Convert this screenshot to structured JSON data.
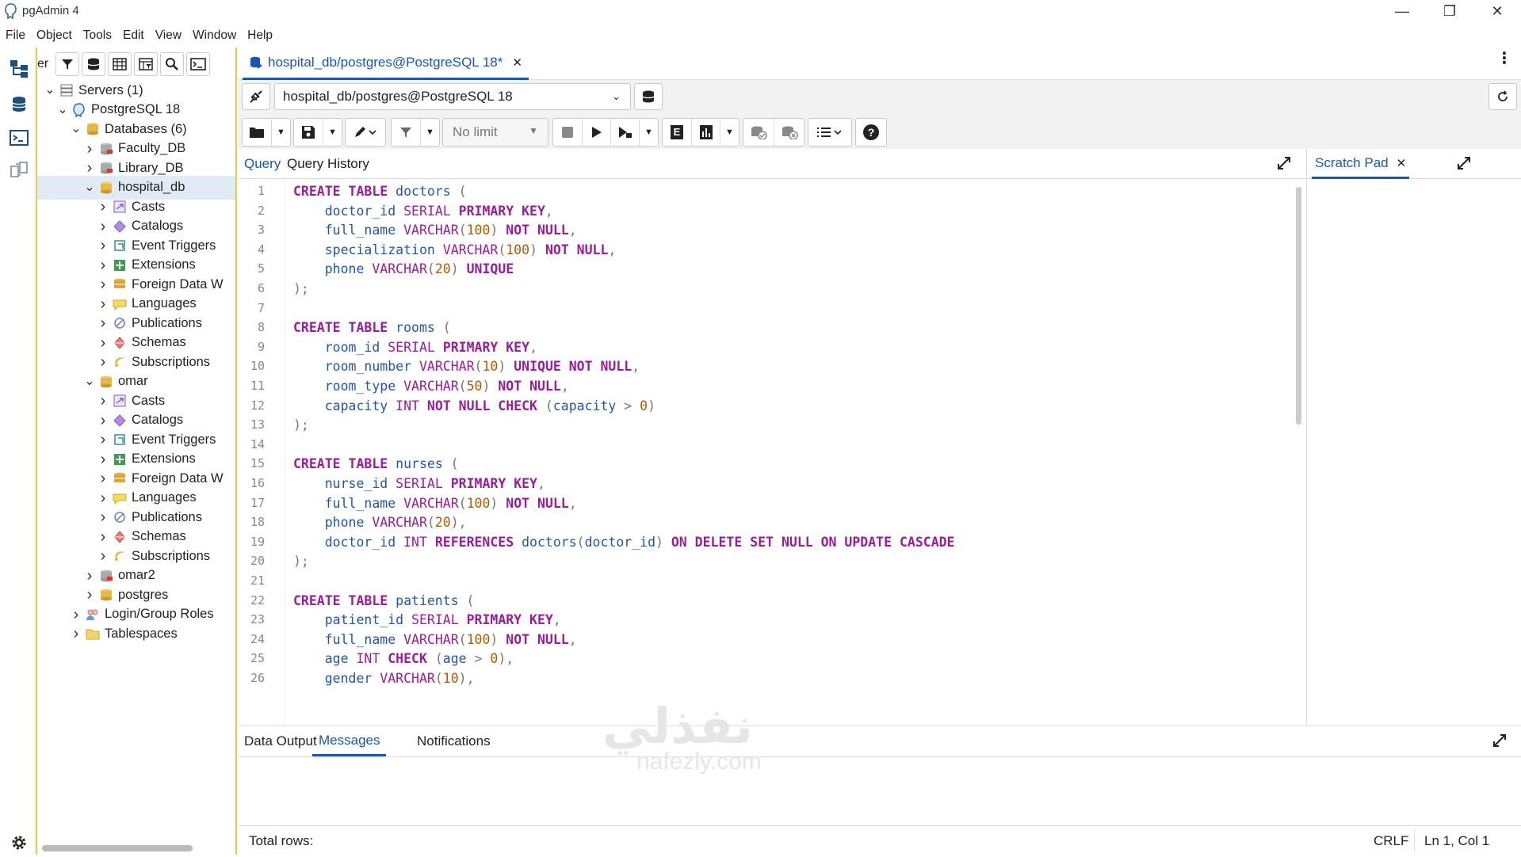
{
  "window": {
    "title": "pgAdmin 4",
    "minimize": "—",
    "maximize": "❐",
    "close": "✕"
  },
  "menu": [
    "File",
    "Object",
    "Tools",
    "Edit",
    "View",
    "Window",
    "Help"
  ],
  "tree_panel": {
    "partial_title": "er"
  },
  "tree": [
    {
      "label": "Servers (1)",
      "depth": 0,
      "expanded": true,
      "icon": "servers-icon"
    },
    {
      "label": "PostgreSQL 18",
      "depth": 1,
      "expanded": true,
      "icon": "postgres-elephant-icon"
    },
    {
      "label": "Databases (6)",
      "depth": 2,
      "expanded": true,
      "icon": "databases-icon"
    },
    {
      "label": "Faculty_DB",
      "depth": 3,
      "expanded": false,
      "icon": "database-disconnected-icon"
    },
    {
      "label": "Library_DB",
      "depth": 3,
      "expanded": false,
      "icon": "database-disconnected-icon"
    },
    {
      "label": "hospital_db",
      "depth": 3,
      "expanded": true,
      "icon": "database-icon",
      "selected": true
    },
    {
      "label": "Casts",
      "depth": 4,
      "expanded": false,
      "icon": "casts-icon"
    },
    {
      "label": "Catalogs",
      "depth": 4,
      "expanded": false,
      "icon": "catalogs-icon"
    },
    {
      "label": "Event Triggers",
      "depth": 4,
      "expanded": false,
      "icon": "event-triggers-icon"
    },
    {
      "label": "Extensions",
      "depth": 4,
      "expanded": false,
      "icon": "extensions-icon"
    },
    {
      "label": "Foreign Data W",
      "depth": 4,
      "expanded": false,
      "icon": "foreign-data-icon"
    },
    {
      "label": "Languages",
      "depth": 4,
      "expanded": false,
      "icon": "languages-icon"
    },
    {
      "label": "Publications",
      "depth": 4,
      "expanded": false,
      "icon": "publications-icon"
    },
    {
      "label": "Schemas",
      "depth": 4,
      "expanded": false,
      "icon": "schemas-icon"
    },
    {
      "label": "Subscriptions",
      "depth": 4,
      "expanded": false,
      "icon": "subscriptions-icon"
    },
    {
      "label": "omar",
      "depth": 3,
      "expanded": true,
      "icon": "database-icon"
    },
    {
      "label": "Casts",
      "depth": 4,
      "expanded": false,
      "icon": "casts-icon"
    },
    {
      "label": "Catalogs",
      "depth": 4,
      "expanded": false,
      "icon": "catalogs-icon"
    },
    {
      "label": "Event Triggers",
      "depth": 4,
      "expanded": false,
      "icon": "event-triggers-icon"
    },
    {
      "label": "Extensions",
      "depth": 4,
      "expanded": false,
      "icon": "extensions-icon"
    },
    {
      "label": "Foreign Data W",
      "depth": 4,
      "expanded": false,
      "icon": "foreign-data-icon"
    },
    {
      "label": "Languages",
      "depth": 4,
      "expanded": false,
      "icon": "languages-icon"
    },
    {
      "label": "Publications",
      "depth": 4,
      "expanded": false,
      "icon": "publications-icon"
    },
    {
      "label": "Schemas",
      "depth": 4,
      "expanded": false,
      "icon": "schemas-icon"
    },
    {
      "label": "Subscriptions",
      "depth": 4,
      "expanded": false,
      "icon": "subscriptions-icon"
    },
    {
      "label": "omar2",
      "depth": 3,
      "expanded": false,
      "icon": "database-disconnected-icon"
    },
    {
      "label": "postgres",
      "depth": 3,
      "expanded": false,
      "icon": "database-icon"
    },
    {
      "label": "Login/Group Roles",
      "depth": 2,
      "expanded": false,
      "icon": "roles-icon"
    },
    {
      "label": "Tablespaces",
      "depth": 2,
      "expanded": false,
      "icon": "tablespaces-icon"
    }
  ],
  "query_tab": {
    "label": "hospital_db/postgres@PostgreSQL 18*",
    "close": "✕"
  },
  "connection": {
    "value": "hospital_db/postgres@PostgreSQL 18"
  },
  "toolbar": {
    "limit": "No limit",
    "explain_label": "E"
  },
  "editor_tabs": {
    "query": "Query",
    "history": "Query History",
    "scratch": "Scratch Pad",
    "scratch_close": "✕"
  },
  "code_lines": [
    [
      [
        "kw",
        "CREATE TABLE "
      ],
      [
        "id",
        "doctors"
      ],
      [
        "pu",
        " ("
      ]
    ],
    [
      [
        "",
        "    "
      ],
      [
        "id",
        "doctor_id"
      ],
      [
        "ty",
        " SERIAL "
      ],
      [
        "kw",
        "PRIMARY KEY"
      ],
      [
        "pu",
        ","
      ]
    ],
    [
      [
        "",
        "    "
      ],
      [
        "id",
        "full_name"
      ],
      [
        "ty",
        " VARCHAR"
      ],
      [
        "pu",
        "("
      ],
      [
        "num",
        "100"
      ],
      [
        "pu",
        ") "
      ],
      [
        "kw",
        "NOT NULL"
      ],
      [
        "pu",
        ","
      ]
    ],
    [
      [
        "",
        "    "
      ],
      [
        "id",
        "specialization"
      ],
      [
        "ty",
        " VARCHAR"
      ],
      [
        "pu",
        "("
      ],
      [
        "num",
        "100"
      ],
      [
        "pu",
        ") "
      ],
      [
        "kw",
        "NOT NULL"
      ],
      [
        "pu",
        ","
      ]
    ],
    [
      [
        "",
        "    "
      ],
      [
        "id",
        "phone"
      ],
      [
        "ty",
        " VARCHAR"
      ],
      [
        "pu",
        "("
      ],
      [
        "num",
        "20"
      ],
      [
        "pu",
        ") "
      ],
      [
        "kw",
        "UNIQUE"
      ]
    ],
    [
      [
        "pu",
        ");"
      ]
    ],
    [
      [
        "",
        ""
      ]
    ],
    [
      [
        "kw",
        "CREATE TABLE "
      ],
      [
        "id",
        "rooms"
      ],
      [
        "pu",
        " ("
      ]
    ],
    [
      [
        "",
        "    "
      ],
      [
        "id",
        "room_id"
      ],
      [
        "ty",
        " SERIAL "
      ],
      [
        "kw",
        "PRIMARY KEY"
      ],
      [
        "pu",
        ","
      ]
    ],
    [
      [
        "",
        "    "
      ],
      [
        "id",
        "room_number"
      ],
      [
        "ty",
        " VARCHAR"
      ],
      [
        "pu",
        "("
      ],
      [
        "num",
        "10"
      ],
      [
        "pu",
        ") "
      ],
      [
        "kw",
        "UNIQUE NOT NULL"
      ],
      [
        "pu",
        ","
      ]
    ],
    [
      [
        "",
        "    "
      ],
      [
        "id",
        "room_type"
      ],
      [
        "ty",
        " VARCHAR"
      ],
      [
        "pu",
        "("
      ],
      [
        "num",
        "50"
      ],
      [
        "pu",
        ") "
      ],
      [
        "kw",
        "NOT NULL"
      ],
      [
        "pu",
        ","
      ]
    ],
    [
      [
        "",
        "    "
      ],
      [
        "id",
        "capacity"
      ],
      [
        "ty",
        " INT "
      ],
      [
        "kw",
        "NOT NULL CHECK"
      ],
      [
        "pu",
        " ("
      ],
      [
        "id",
        "capacity"
      ],
      [
        "pu",
        " > "
      ],
      [
        "num",
        "0"
      ],
      [
        "pu",
        ")"
      ]
    ],
    [
      [
        "pu",
        ");"
      ]
    ],
    [
      [
        "",
        ""
      ]
    ],
    [
      [
        "kw",
        "CREATE TABLE "
      ],
      [
        "id",
        "nurses"
      ],
      [
        "pu",
        " ("
      ]
    ],
    [
      [
        "",
        "    "
      ],
      [
        "id",
        "nurse_id"
      ],
      [
        "ty",
        " SERIAL "
      ],
      [
        "kw",
        "PRIMARY KEY"
      ],
      [
        "pu",
        ","
      ]
    ],
    [
      [
        "",
        "    "
      ],
      [
        "id",
        "full_name"
      ],
      [
        "ty",
        " VARCHAR"
      ],
      [
        "pu",
        "("
      ],
      [
        "num",
        "100"
      ],
      [
        "pu",
        ") "
      ],
      [
        "kw",
        "NOT NULL"
      ],
      [
        "pu",
        ","
      ]
    ],
    [
      [
        "",
        "    "
      ],
      [
        "id",
        "phone"
      ],
      [
        "ty",
        " VARCHAR"
      ],
      [
        "pu",
        "("
      ],
      [
        "num",
        "20"
      ],
      [
        "pu",
        "),"
      ]
    ],
    [
      [
        "",
        "    "
      ],
      [
        "id",
        "doctor_id"
      ],
      [
        "ty",
        " INT "
      ],
      [
        "kw",
        "REFERENCES "
      ],
      [
        "id",
        "doctors"
      ],
      [
        "pu",
        "("
      ],
      [
        "id",
        "doctor_id"
      ],
      [
        "pu",
        ") "
      ],
      [
        "kw",
        "ON DELETE SET NULL ON UPDATE CASCADE"
      ]
    ],
    [
      [
        "pu",
        ");"
      ]
    ],
    [
      [
        "",
        ""
      ]
    ],
    [
      [
        "kw",
        "CREATE TABLE "
      ],
      [
        "id",
        "patients"
      ],
      [
        "pu",
        " ("
      ]
    ],
    [
      [
        "",
        "    "
      ],
      [
        "id",
        "patient_id"
      ],
      [
        "ty",
        " SERIAL "
      ],
      [
        "kw",
        "PRIMARY KEY"
      ],
      [
        "pu",
        ","
      ]
    ],
    [
      [
        "",
        "    "
      ],
      [
        "id",
        "full_name"
      ],
      [
        "ty",
        " VARCHAR"
      ],
      [
        "pu",
        "("
      ],
      [
        "num",
        "100"
      ],
      [
        "pu",
        ") "
      ],
      [
        "kw",
        "NOT NULL"
      ],
      [
        "pu",
        ","
      ]
    ],
    [
      [
        "",
        "    "
      ],
      [
        "id",
        "age"
      ],
      [
        "ty",
        " INT "
      ],
      [
        "kw",
        "CHECK"
      ],
      [
        "pu",
        " ("
      ],
      [
        "id",
        "age"
      ],
      [
        "pu",
        " > "
      ],
      [
        "num",
        "0"
      ],
      [
        "pu",
        "),"
      ]
    ],
    [
      [
        "",
        "    "
      ],
      [
        "id",
        "gender"
      ],
      [
        "ty",
        " VARCHAR"
      ],
      [
        "pu",
        "("
      ],
      [
        "num",
        "10"
      ],
      [
        "pu",
        "),"
      ]
    ]
  ],
  "output_tabs": {
    "data": "Data Output",
    "messages": "Messages",
    "notifications": "Notifications"
  },
  "status": {
    "total_rows": "Total rows:",
    "eol": "CRLF",
    "position": "Ln 1, Col 1"
  },
  "watermark": {
    "arabic": "نفذلي",
    "latin": "nafezly.com"
  },
  "colors": {
    "accent": "#1a56b0",
    "panel_border": "#e8c94f",
    "keyword": "#9b1c9b",
    "identifier": "#2255aa",
    "number": "#b35900"
  }
}
